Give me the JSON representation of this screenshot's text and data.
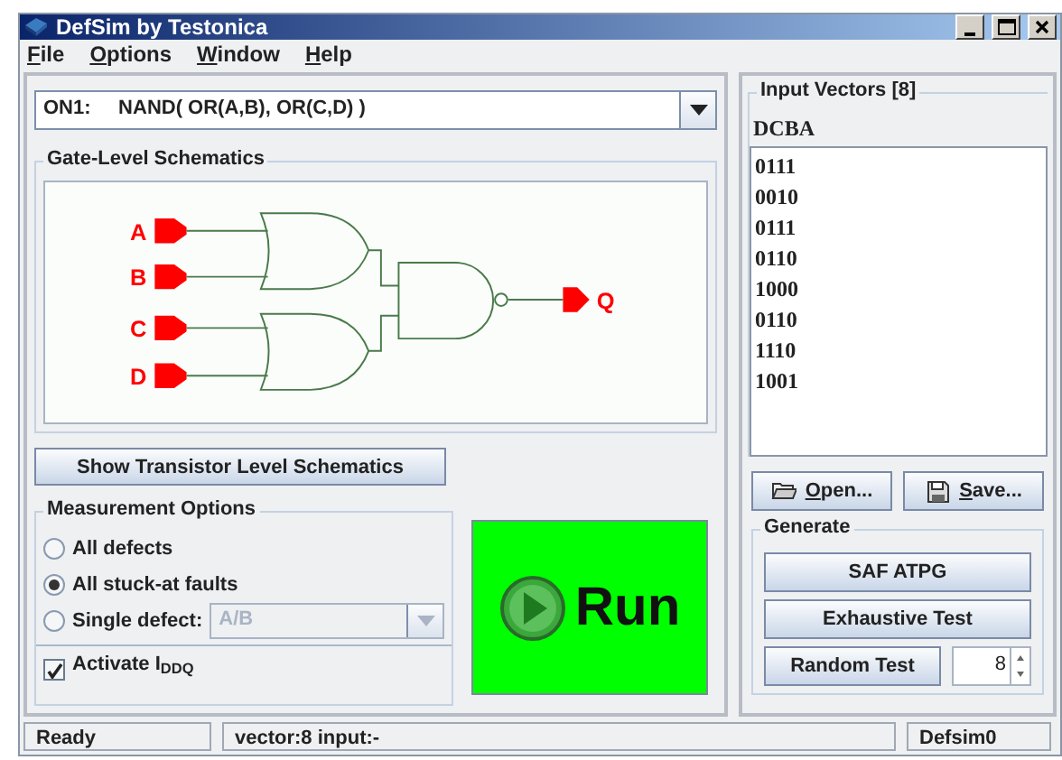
{
  "window": {
    "title": "DefSim by Testonica"
  },
  "menu": [
    "File",
    "Options",
    "Window",
    "Help"
  ],
  "circuit_select": {
    "value": "ON1:     NAND( OR(A,B), OR(C,D) )"
  },
  "schematic": {
    "title": "Gate-Level Schematics",
    "inputs": [
      "A",
      "B",
      "C",
      "D"
    ],
    "output": "Q"
  },
  "transistor_button": "Show Transistor Level Schematics",
  "measurement": {
    "title": "Measurement Options",
    "options": [
      {
        "label": "All defects",
        "selected": false
      },
      {
        "label": "All stuck-at faults",
        "selected": true
      },
      {
        "label": "Single defect:",
        "selected": false
      }
    ],
    "defect_select": {
      "value": "A/B",
      "disabled": true
    },
    "iddq": {
      "label": "Activate I$_{DDQ}$",
      "checked": true
    }
  },
  "run_button": "Run",
  "vectors": {
    "title": "Input Vectors [8]",
    "header": "DCBA",
    "items": [
      "0111",
      "0010",
      "0111",
      "0110",
      "1000",
      "0110",
      "1110",
      "1001"
    ]
  },
  "file_buttons": [
    "Open...",
    "Save..."
  ],
  "generate": {
    "title": "Generate",
    "buttons": [
      "SAF ATPG",
      "Exhaustive Test"
    ],
    "random_button": "Random Test",
    "count": "8"
  },
  "status_bar": [
    "Ready",
    "vector:8 input:-",
    "Defsim0"
  ]
}
